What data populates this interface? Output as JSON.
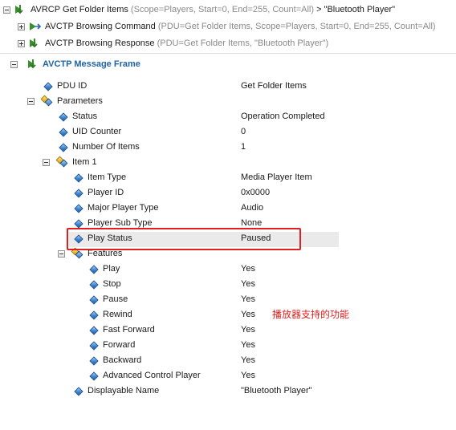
{
  "tree": {
    "root": {
      "name": "AVRCP Get Folder Items",
      "params": "(Scope=Players, Start=0, End=255, Count=All)",
      "suffix": "> \"Bluetooth Player\""
    },
    "children": [
      {
        "name": "AVCTP Browsing Command",
        "params": "(PDU=Get Folder Items, Scope=Players, Start=0, End=255, Count=All)"
      },
      {
        "name": "AVCTP Browsing Response",
        "params": "(PDU=Get Folder Items, \"Bluetooth Player\")"
      }
    ]
  },
  "details": {
    "title": "AVCTP Message Frame",
    "fields": [
      {
        "label": "PDU ID",
        "value": "Get Folder Items"
      },
      {
        "label": "Parameters",
        "value": ""
      },
      {
        "label": "Status",
        "value": "Operation Completed"
      },
      {
        "label": "UID Counter",
        "value": "0"
      },
      {
        "label": "Number Of Items",
        "value": "1"
      },
      {
        "label": "Item 1",
        "value": ""
      },
      {
        "label": "Item Type",
        "value": "Media Player Item"
      },
      {
        "label": "Player ID",
        "value": "0x0000"
      },
      {
        "label": "Major Player Type",
        "value": "Audio"
      },
      {
        "label": "Player Sub Type",
        "value": "None"
      },
      {
        "label": "Play Status",
        "value": "Paused"
      },
      {
        "label": "Features",
        "value": ""
      },
      {
        "label": "Play",
        "value": "Yes"
      },
      {
        "label": "Stop",
        "value": "Yes"
      },
      {
        "label": "Pause",
        "value": "Yes"
      },
      {
        "label": "Rewind",
        "value": "Yes"
      },
      {
        "label": "Fast Forward",
        "value": "Yes"
      },
      {
        "label": "Forward",
        "value": "Yes"
      },
      {
        "label": "Backward",
        "value": "Yes"
      },
      {
        "label": "Advanced Control Player",
        "value": "Yes"
      },
      {
        "label": "Displayable Name",
        "value": "\"Bluetooth Player\""
      }
    ]
  },
  "annotation": "播放器支持的功能",
  "colors": {
    "highlight_box": "#e02020",
    "title": "#1d63a8",
    "selected_row": "#eaeaea"
  }
}
